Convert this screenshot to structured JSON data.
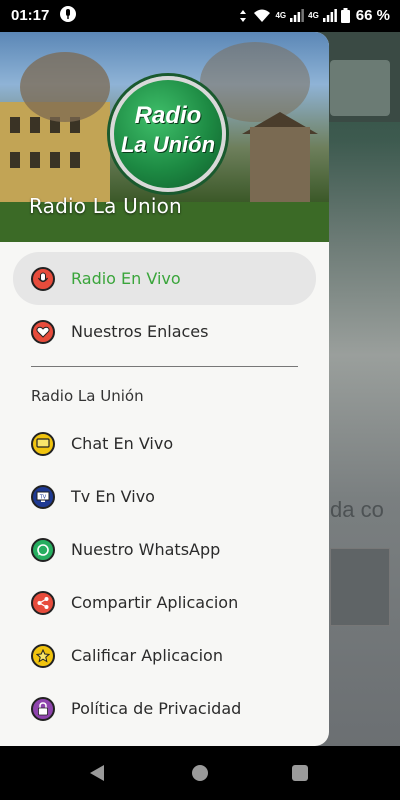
{
  "status_bar": {
    "time": "01:17",
    "network_1": "4G",
    "network_2": "4G",
    "battery": "66 %"
  },
  "background_app": {
    "peek_text": "da co"
  },
  "drawer": {
    "logo_line1": "Radio",
    "logo_line2": "La Unión",
    "title": "Radio La Union",
    "items": [
      {
        "label": "Radio En Vivo",
        "icon": "radio-mic-icon",
        "active": true
      },
      {
        "label": "Nuestros Enlaces",
        "icon": "heart-icon"
      }
    ],
    "section_label": "Radio La Unión",
    "section_items": [
      {
        "label": "Chat En Vivo",
        "icon": "chat-icon"
      },
      {
        "label": "Tv En Vivo",
        "icon": "tv-icon"
      },
      {
        "label": "Nuestro WhatsApp",
        "icon": "whatsapp-icon"
      },
      {
        "label": "Compartir Aplicacion",
        "icon": "share-icon"
      },
      {
        "label": "Calificar Aplicacion",
        "icon": "star-icon"
      },
      {
        "label": "Política de Privacidad",
        "icon": "lock-icon"
      }
    ]
  },
  "colors": {
    "active": "#3aa53b",
    "drawer_bg": "#f7f7f5"
  }
}
